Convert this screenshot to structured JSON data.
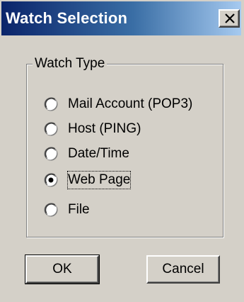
{
  "window": {
    "title": "Watch Selection"
  },
  "icons": {
    "close": "close-icon"
  },
  "group": {
    "label": "Watch Type",
    "options": [
      {
        "label": "Mail Account (POP3)",
        "selected": false
      },
      {
        "label": "Host (PING)",
        "selected": false
      },
      {
        "label": "Date/Time",
        "selected": false
      },
      {
        "label": "Web Page",
        "selected": true
      },
      {
        "label": "File",
        "selected": false
      }
    ]
  },
  "buttons": {
    "ok_label": "OK",
    "cancel_label": "Cancel"
  },
  "colors": {
    "title_gradient_start": "#0a246a",
    "title_gradient_end": "#a6caf0",
    "face": "#d4d0c8"
  }
}
